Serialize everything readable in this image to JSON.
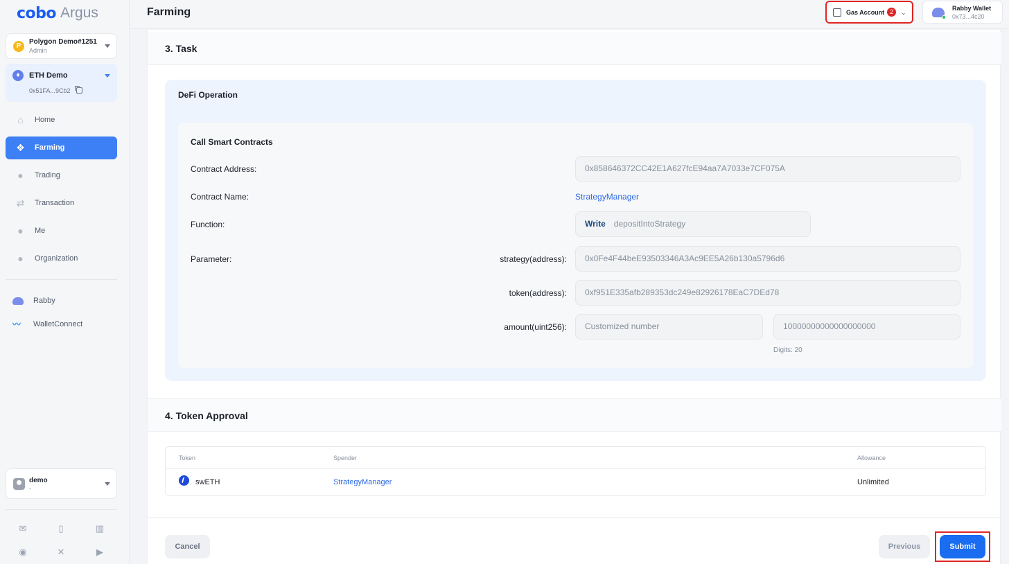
{
  "brand": {
    "logo_main": "cobo",
    "logo_sub": "Argus",
    "accent": "#3d7ff5"
  },
  "org": {
    "name": "Polygon Demo#1251",
    "role": "Admin",
    "avatar_letter": "P"
  },
  "wallet": {
    "name": "ETH Demo",
    "address": "0x51FA...9Cb2"
  },
  "nav": [
    {
      "label": "Home",
      "icon": "home-icon"
    },
    {
      "label": "Farming",
      "icon": "farming-icon",
      "active": true
    },
    {
      "label": "Trading",
      "icon": "trading-icon"
    },
    {
      "label": "Transaction",
      "icon": "transaction-icon"
    },
    {
      "label": "Me",
      "icon": "user-icon"
    },
    {
      "label": "Organization",
      "icon": "organization-icon"
    }
  ],
  "extensions": [
    {
      "label": "Rabby",
      "icon": "rabby-icon"
    },
    {
      "label": "WalletConnect",
      "icon": "walletconnect-icon"
    }
  ],
  "user": {
    "name": "demo",
    "sub": "-"
  },
  "header": {
    "title": "Farming",
    "gas_account": {
      "label": "Gas Account",
      "count": "2"
    },
    "rabby": {
      "name": "Rabby Wallet",
      "address": "0x73...4c20"
    }
  },
  "task": {
    "section_title": "3. Task",
    "defi_title": "DeFi Operation",
    "call_title": "Call Smart Contracts",
    "contract_address_label": "Contract Address:",
    "contract_address": "0x858646372CC42E1A627fcE94aa7A7033e7CF075A",
    "contract_name_label": "Contract Name:",
    "contract_name": "StrategyManager",
    "function_label": "Function:",
    "function_mode": "Write",
    "function_name": "depositIntoStrategy",
    "parameter_label": "Parameter:",
    "params": {
      "strategy_label": "strategy(address):",
      "strategy_value": "0x0Fe4F44beE93503346A3Ac9EE5A26b130a5796d6",
      "token_label": "token(address):",
      "token_value": "0xf951E335afb289353dc249e82926178EaC7DEd78",
      "amount_label": "amount(uint256):",
      "amount_placeholder": "Customized number",
      "amount_value": "10000000000000000000",
      "digits": "Digits: 20"
    }
  },
  "approval": {
    "section_title": "4. Token Approval",
    "columns": [
      "Token",
      "Spender",
      "Allowance"
    ],
    "rows": [
      {
        "token": "swETH",
        "spender": "StrategyManager",
        "allowance": "Unlimited"
      }
    ]
  },
  "actions": {
    "cancel": "Cancel",
    "previous": "Previous",
    "submit": "Submit"
  }
}
